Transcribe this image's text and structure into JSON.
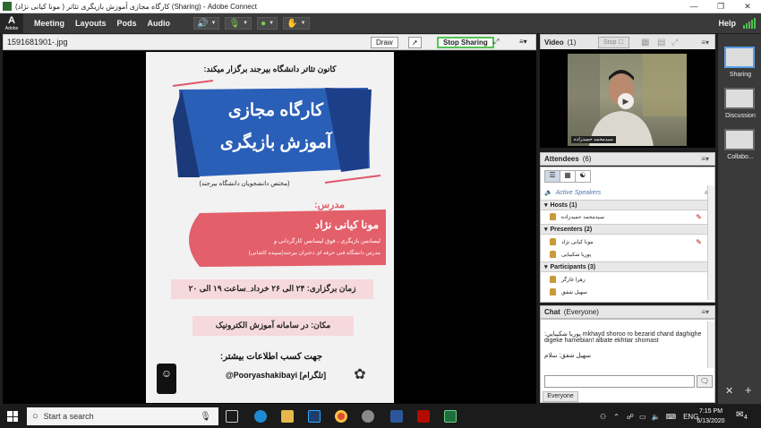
{
  "window": {
    "title": "کارگاه مجازی آموزش بازیگری تئاتر ( مونا کیانی نژاد) (Sharing) - Adobe Connect"
  },
  "logo": {
    "text": "Adobe"
  },
  "menu": {
    "items": [
      "Meeting",
      "Layouts",
      "Pods",
      "Audio"
    ],
    "help": "Help"
  },
  "share": {
    "file_name": "1591681901-.jpg",
    "draw_label": "Draw",
    "stop_sharing_label": "Stop Sharing"
  },
  "poster": {
    "org_line": "کانون تئاتر دانشگاه بیرجند برگزار میکند:",
    "title_1": "کارگاه مجازی",
    "title_2": "آموزش بازیگری",
    "subtitle": "(مختص دانشجویان دانشگاه بیرجند)",
    "teacher_label": "مدرس:",
    "teacher_name": "مونا کیانی نژاد",
    "teacher_desc_1": "لیسانس بازیگری ، فوق لیسانس کارگردانی و",
    "teacher_desc_2": "مدرس دانشگاه فنی حرفه ای دختران بیرجند(سپیده کاشانی)",
    "schedule": "زمان برگزاری: ۲۴ الی ۲۶ خرداد_ساعت ۱۹ الی ۲۰",
    "place": "مکان: در سامانه آموزش الکترونیک",
    "info_label": "جهت کسب اطلاعات بیشتر:",
    "telegram": "[تلگرام]",
    "handle": "@Pooryashakibayi"
  },
  "video": {
    "title": "Video",
    "count": "(1)",
    "stop_label": "Stop",
    "caption": "سیدمحمد حمیدزاده"
  },
  "attendees": {
    "title": "Attendees",
    "count": "(6)",
    "active_speakers": "Active Speakers",
    "hosts_label": "Hosts (1)",
    "hosts": [
      "سیدمحمد حمیدزاده"
    ],
    "presenters_label": "Presenters (2)",
    "presenters": [
      "مونا کیانی نژاد",
      "پوریا شکیبایی"
    ],
    "participants_label": "Participants (3)",
    "participants": [
      "زهرا غارگر",
      "سهیل شفق"
    ]
  },
  "chat": {
    "title": "Chat",
    "audience": "(Everyone)",
    "msg1_name": "پوریا شکیبایی:",
    "msg1_text": "mkhayd shoroo ro bezarid chand daghighe digeke hamebian! albate ekhtiar shomast",
    "msg2": "سهیل شفق: سلام",
    "tab_label": "Everyone"
  },
  "layouts": {
    "items": [
      "Sharing",
      "Discussion",
      "Collabo..."
    ]
  },
  "taskbar": {
    "search_placeholder": "Start a search",
    "lang": "ENG",
    "time": "7:15 PM",
    "date": "6/13/2020",
    "notif_count": "4"
  }
}
